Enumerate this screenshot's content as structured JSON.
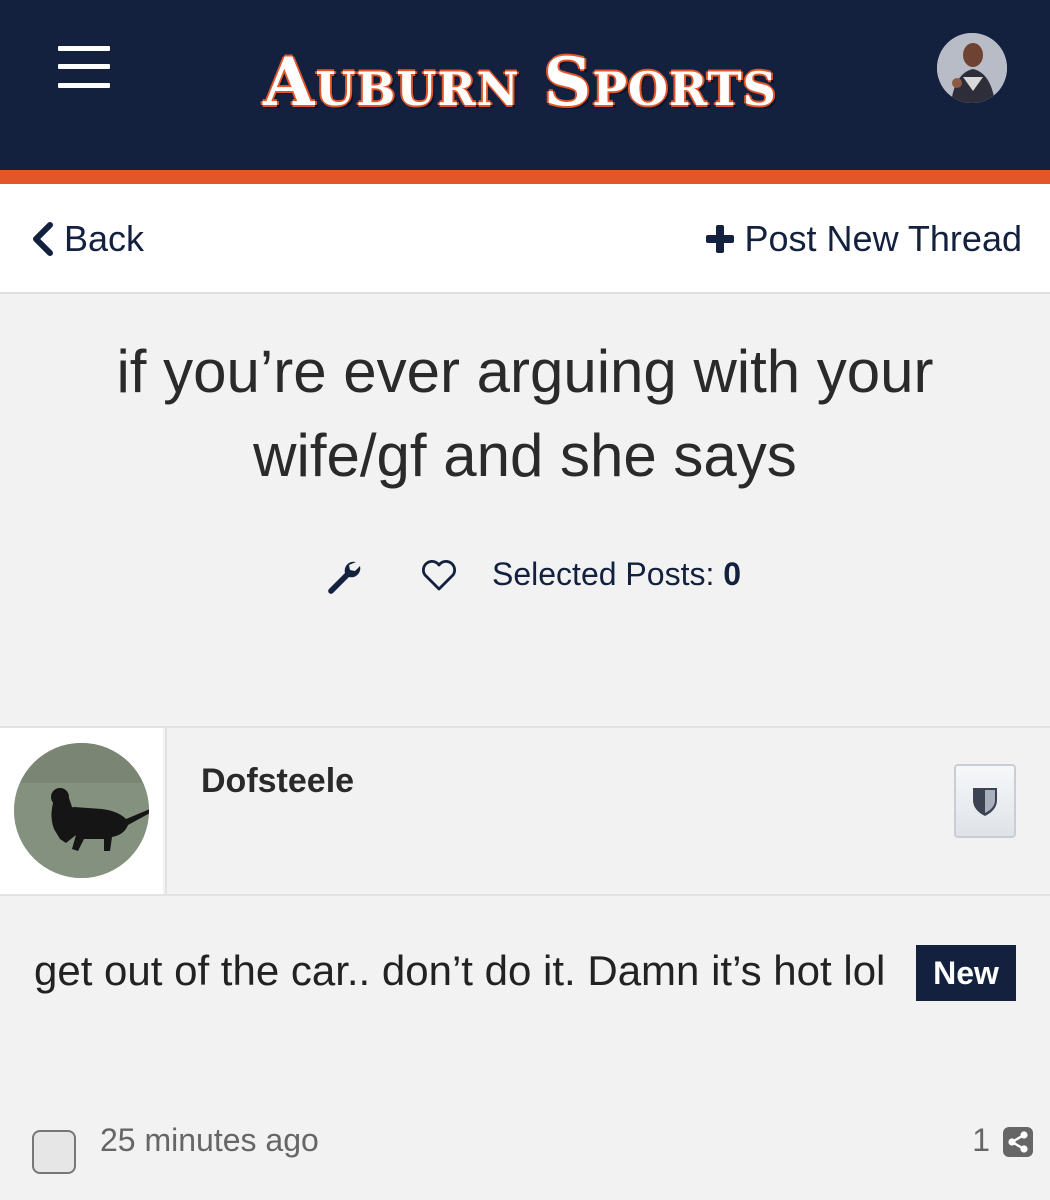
{
  "header": {
    "logo_text": "Auburn Sports",
    "colors": {
      "navy": "#13213f",
      "orange": "#e2562a"
    }
  },
  "subnav": {
    "back_label": "Back",
    "new_thread_label": "Post New Thread"
  },
  "thread": {
    "title": "if you’re ever arguing with your wife/gf and she says",
    "selected_posts_label": "Selected Posts:",
    "selected_posts_count": "0"
  },
  "post": {
    "username": "Dofsteele",
    "body": "get out of the car.. don’t do it. Damn it’s hot lol",
    "badge": "New",
    "time": "25 minutes ago",
    "post_number": "1"
  },
  "icons": {
    "menu": "hamburger-menu-icon",
    "back": "chevron-left-icon",
    "new_thread": "plus-icon",
    "tools": "wrench-icon",
    "like": "heart-icon",
    "moderation": "shield-icon",
    "share": "share-icon"
  }
}
